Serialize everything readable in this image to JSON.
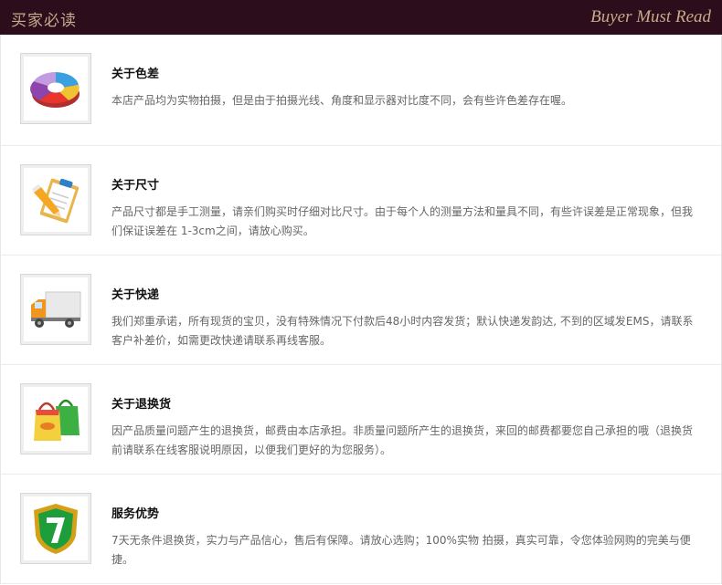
{
  "header": {
    "title": "买家必读",
    "subtitle": "Buyer Must Read"
  },
  "items": [
    {
      "icon": "color-pie-icon",
      "title": "关于色差",
      "text": "本店产品均为实物拍摄，但是由于拍摄光线、角度和显示器对比度不同，会有些许色差存在喔。"
    },
    {
      "icon": "clipboard-pencil-icon",
      "title": "关于尺寸",
      "text": "产品尺寸都是手工测量，请亲们购买时仔细对比尺寸。由于每个人的测量方法和量具不同，有些许误差是正常现象，但我们保证误差在 1-3cm之间，请放心购买。"
    },
    {
      "icon": "delivery-truck-icon",
      "title": "关于快递",
      "text": "我们郑重承诺，所有现货的宝贝，没有特殊情况下付款后48小时内容发货；默认快递发韵达, 不到的区域发EMS，请联系客户补差价，如需更改快递请联系再线客服。"
    },
    {
      "icon": "shopping-bags-icon",
      "title": "关于退换货",
      "text": "因产品质量问题产生的退换货，邮费由本店承担。非质量问题所产生的退换货，来回的邮费都要您自己承担的哦（退换货前请联系在线客服说明原因，以便我们更好的为您服务）。"
    },
    {
      "icon": "shield-seven-icon",
      "title": "服务优势",
      "text": "7天无条件退换货，实力与产品信心，售后有保障。请放心选购；100%实物 拍摄，真实可靠，令您体验网购的完美与便捷。"
    }
  ],
  "colors": {
    "header_bg": "#2c0d1c",
    "header_text": "#c8a98a"
  }
}
